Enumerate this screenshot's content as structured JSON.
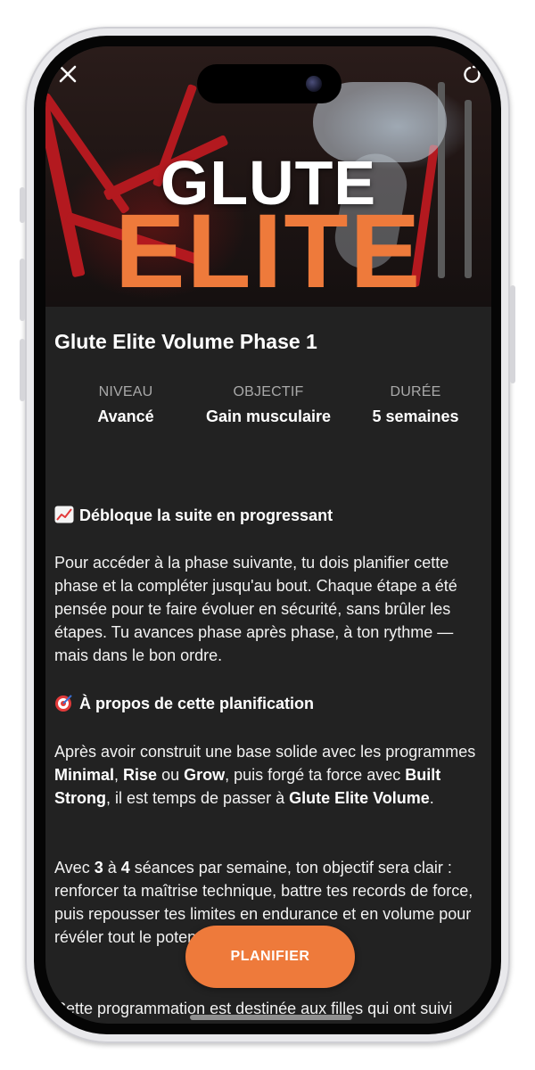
{
  "hero": {
    "title_top": "GLUTE",
    "title_bottom": "ELITE"
  },
  "program": {
    "title": "Glute Elite Volume Phase 1"
  },
  "stats": [
    {
      "label": "NIVEAU",
      "value": "Avancé"
    },
    {
      "label": "OBJECTIF",
      "value": "Gain musculaire"
    },
    {
      "label": "DURÉE",
      "value": "5 semaines"
    }
  ],
  "sections": {
    "unlock": {
      "heading": "Débloque la suite en progressant",
      "icon": "chart-increasing-icon",
      "body": "Pour accéder à la phase suivante, tu dois planifier cette phase et la compléter jusqu'au bout. Chaque étape a été pensée pour te faire évoluer en sécurité, sans brûler les étapes. Tu avances phase après phase, à ton rythme — mais dans le bon ordre."
    },
    "about": {
      "heading": "À propos de cette planification",
      "icon": "target-icon",
      "p1": {
        "t1": "Après avoir construit une base solide avec les programmes ",
        "b1": "Minimal",
        "t2": ", ",
        "b2": "Rise",
        "t3": " ou ",
        "b3": "Grow",
        "t4": ", puis forgé ta force avec ",
        "b4": "Built Strong",
        "t5": ", il est temps de passer à ",
        "b5": "Glute Elite Volume",
        "t6": "."
      },
      "p2": {
        "t1": "Avec ",
        "b1": "3",
        "t2": " à ",
        "b2": "4",
        "t3": " séances par semaine, ton objectif sera clair : renforcer ta maîtrise technique, battre tes records de force, puis repousser tes limites en endurance et en volume pour révéler tout le potentiel de tes fessiers."
      },
      "p3": "Cette programmation est destinée aux filles qui ont suivi toutes les étapes et sont prêtes à aller encore plus loin."
    }
  },
  "cta": {
    "label": "PLANIFIER"
  },
  "colors": {
    "accent": "#ee7a3b",
    "background": "#222222",
    "muted_label": "#a9a9a9"
  }
}
